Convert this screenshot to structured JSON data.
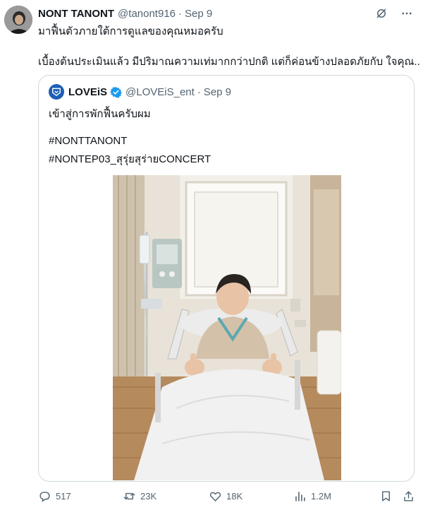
{
  "tweet": {
    "display_name": "NONT TANONT",
    "handle": "@tanont916",
    "separator": "·",
    "date": "Sep 9",
    "text_line1": "มาฟื้นตัวภายใต้การดูแลของคุณหมอครับ",
    "text_line2": "เบื้องต้นประเมินแล้ว มีปริมาณความเท่มากกว่าปกติ แต่ก็ค่อนข้างปลอดภัยกับ ใจคุณ.."
  },
  "quote": {
    "name": "LOVEiS",
    "handle": "@LOVEiS_ent",
    "separator": "·",
    "date": "Sep 9",
    "text_line1": "เข้าสู่การพักฟื้นครับผม",
    "hashtag1": "#NONTTANONT",
    "hashtag2": "#NONTEP03_สุรุ่ยสุร่ายCONCERT"
  },
  "actions": {
    "replies": "517",
    "retweets": "23K",
    "likes": "18K",
    "views": "1.2M"
  },
  "icons": {
    "header": [
      "grok-icon",
      "more-icon"
    ],
    "actions": [
      "reply-icon",
      "retweet-icon",
      "like-icon",
      "views-icon",
      "bookmark-icon",
      "share-icon"
    ]
  },
  "colors": {
    "text": "#0f1419",
    "secondary": "#536471",
    "border": "#cfd9de",
    "verified": "#1d9bf0"
  }
}
